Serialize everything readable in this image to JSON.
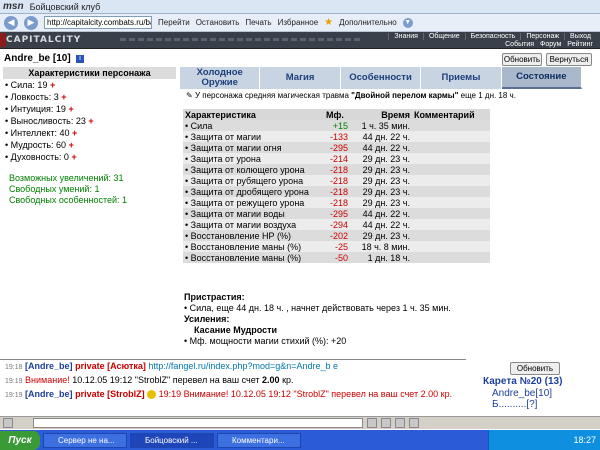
{
  "browser": {
    "logo": "msn",
    "title": "Бойцовский клуб",
    "address": "http://capitalcity.combats.ru/batt",
    "buttons": [
      "Перейти",
      "Остановить",
      "Печать",
      "Избранное",
      "Дополнительно"
    ]
  },
  "site": {
    "brand": "CAPITALCITY",
    "menu_top": [
      "Знания",
      "Общение",
      "Безопасность",
      "Персонаж",
      "Выход"
    ],
    "menu_bottom": [
      "События",
      "Форум",
      "Рейтинг"
    ]
  },
  "user": {
    "nick": "Andre_be [10]",
    "info_icon": "i",
    "refresh_label": "Обновить",
    "back_label": "Вернуться"
  },
  "left": {
    "title": "Характеристики персонажа",
    "stats": [
      {
        "label": "• Сила: 19"
      },
      {
        "label": "• Ловкость: 3"
      },
      {
        "label": "• Интуиция: 19"
      },
      {
        "label": "• Выносливость: 23"
      },
      {
        "label": "• Интеллект: 40"
      },
      {
        "label": "• Мудрость: 60"
      },
      {
        "label": "• Духовность: 0"
      }
    ],
    "plus": "+",
    "increases": "Возможных увеличений: 31",
    "free_skills": "Свободных умений: 1",
    "free_features": "Свободных особенностей: 1"
  },
  "tabs": [
    {
      "label": "Холодное Оружие"
    },
    {
      "label": "Магия"
    },
    {
      "label": "Особенности"
    },
    {
      "label": "Приемы"
    },
    {
      "label": "Состояние"
    }
  ],
  "injury": {
    "prefix": "У персонажа средняя магическая травма ",
    "name": "\"Двойной перелом кармы\"",
    "suffix": " еще 1 дн. 18 ч."
  },
  "table": {
    "headers": [
      "Характеристика",
      "Мф.",
      "Время",
      "Комментарий"
    ],
    "rows": [
      {
        "name": "• Сила",
        "mf": "+15",
        "time": "1 ч. 35 мин.",
        "comment": ""
      },
      {
        "name": "• Защита от магии",
        "mf": "-133",
        "time": "44 дн. 22 ч.",
        "comment": ""
      },
      {
        "name": "• Защита от магии огня",
        "mf": "-295",
        "time": "44 дн. 22 ч.",
        "comment": ""
      },
      {
        "name": "• Защита от урона",
        "mf": "-214",
        "time": "29 дн. 23 ч.",
        "comment": ""
      },
      {
        "name": "• Защита от колющего урона",
        "mf": "-218",
        "time": "29 дн. 23 ч.",
        "comment": ""
      },
      {
        "name": "• Защита от рубящего урона",
        "mf": "-218",
        "time": "29 дн. 23 ч.",
        "comment": ""
      },
      {
        "name": "• Защита от дробящего урона",
        "mf": "-218",
        "time": "29 дн. 23 ч.",
        "comment": ""
      },
      {
        "name": "• Защита от режущего урона",
        "mf": "-218",
        "time": "29 дн. 23 ч.",
        "comment": ""
      },
      {
        "name": "• Защита от магии воды",
        "mf": "-295",
        "time": "44 дн. 22 ч.",
        "comment": ""
      },
      {
        "name": "• Защита от магии воздуха",
        "mf": "-294",
        "time": "44 дн. 22 ч.",
        "comment": ""
      },
      {
        "name": "• Восстановление НР (%)",
        "mf": "-202",
        "time": "29 дн. 23 ч.",
        "comment": ""
      },
      {
        "name": "• Восстановление маны (%)",
        "mf": "-25",
        "time": "18 ч. 8 мин.",
        "comment": ""
      },
      {
        "name": "• Восстановление маны (%)",
        "mf": "-50",
        "time": "1 дн. 18 ч.",
        "comment": ""
      }
    ]
  },
  "effects": {
    "pristrastia_title": "Пристрастия:",
    "pristrastia_text": "• Сила, еще 44 дн. 18 ч. , начнет действовать через 1 ч. 35 мин.",
    "usilenia_title": "Усиления:",
    "usilenia_sub": "Касание Мудрости",
    "usilenia_text": "• Мф. мощности магии стихий (%): +20"
  },
  "chat": {
    "lines": [
      {
        "time": "19:18",
        "nick": "[Andre_be]",
        "priv": "private [Асютка]",
        "text": "http://fangel.ru/index.php?mod=g&n=Andre_b e"
      },
      {
        "time": "19:19",
        "warn": "Внимание!",
        "text": " 10.12.05 19:12 \"StroblZ\" перевел на ваш счет ",
        "amount": "2.00",
        "unit": " кр."
      },
      {
        "time": "19:19",
        "nick": "[Andre_be]",
        "priv": "private [StroblZ]",
        "text": "19:19 Внимание! 10.12.05 19:12 \"StroblZ\" перевел на ваш счет 2.00 кр."
      }
    ],
    "refresh_label": "Обновить",
    "room_title": "Карета №20 (13)",
    "room_user": "Andre_be[10]",
    "room_user2": "Б..........[?]"
  },
  "taskbar": {
    "start": "Пуск",
    "tasks": [
      "Сервер не на...",
      "Бойцовский ...",
      "Комментари..."
    ],
    "time": "18:27"
  }
}
